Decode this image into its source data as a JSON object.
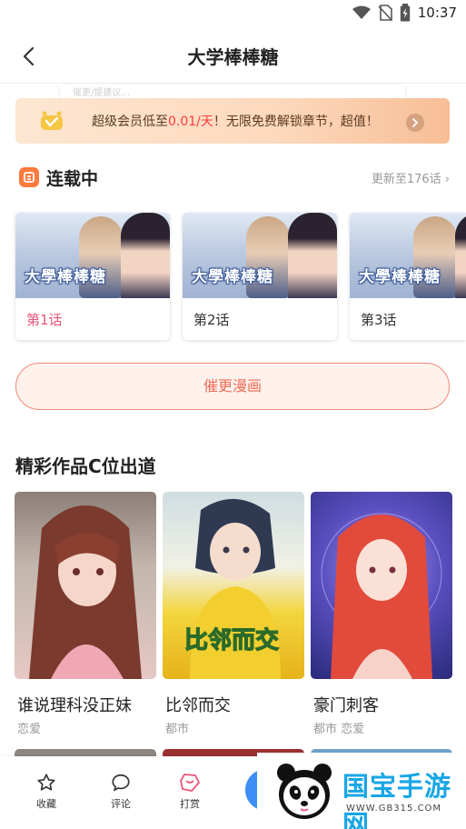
{
  "status_bar": {
    "time": "10:37"
  },
  "header": {
    "title": "大学棒棒糖"
  },
  "search_remnant": {
    "placeholder": "催更/提建议..."
  },
  "vip_banner": {
    "prefix": "超级会员低至",
    "price": "0.01/天",
    "suffix": "！无限免费解锁章节，超值！"
  },
  "serial": {
    "title": "连载中",
    "update_text": "更新至176话 ›"
  },
  "episodes": [
    {
      "label": "第1话",
      "logo_text": "大學棒棒糖",
      "active": true
    },
    {
      "label": "第2话",
      "logo_text": "大學棒棒糖",
      "active": false
    },
    {
      "label": "第3话",
      "logo_text": "大學棒棒糖",
      "active": false
    }
  ],
  "urge_button": {
    "label": "催更漫画"
  },
  "featured": {
    "title": "精彩作品C位出道",
    "works": [
      {
        "title": "谁说理科没正妹",
        "tags": "恋爱"
      },
      {
        "title": "比邻而交",
        "tags": "都市",
        "cover_text": "比邻而交"
      },
      {
        "title": "豪门刺客",
        "tags": "都市 恋爱"
      }
    ]
  },
  "bottom_bar": {
    "tabs": [
      {
        "label": "收藏",
        "icon": "star-icon"
      },
      {
        "label": "评论",
        "icon": "comment-icon"
      },
      {
        "label": "打赏",
        "icon": "gift-icon"
      }
    ]
  },
  "watermark": {
    "text": "国宝手游网",
    "url": "WWW.GB315.COM"
  },
  "colors": {
    "accent_pink": "#e8557a",
    "urge_red": "#ef6d58",
    "price_red": "#ff3b3b",
    "read_blue": "#3d8ef5",
    "watermark_blue": "#19a6e6"
  }
}
